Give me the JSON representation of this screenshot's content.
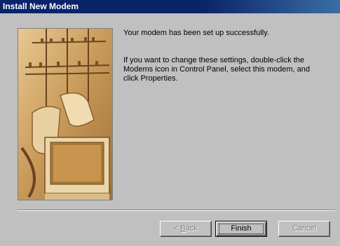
{
  "window": {
    "title": "Install New Modem"
  },
  "message": {
    "line1": "Your modem has been set up successfully.",
    "line2": "If you want to change these settings, double-click the Modems icon in Control Panel, select this modem, and click Properties."
  },
  "buttons": {
    "back": {
      "prefix": "< ",
      "mnemonic": "B",
      "rest": "ack",
      "enabled": false
    },
    "finish": {
      "label": "Finish",
      "enabled": true
    },
    "cancel": {
      "label": "Cancel",
      "enabled": false
    }
  },
  "illustration": {
    "icon": "modem-telephone-monitor-illustration"
  },
  "colors": {
    "titlebar": "#0a246a",
    "face": "#c0c0c0",
    "sepia": "#c8a060"
  }
}
